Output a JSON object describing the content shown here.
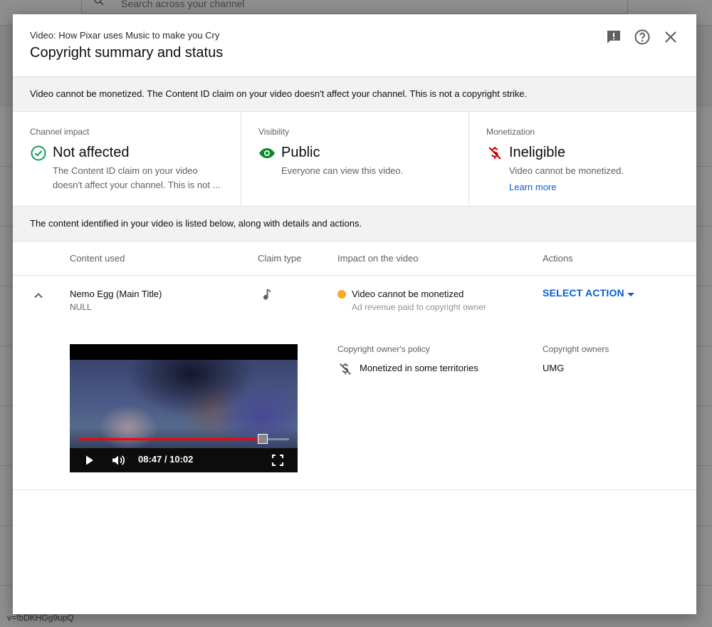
{
  "background": {
    "search_placeholder": "Search across your channel",
    "footer_text": "v=fbDKHGg9upQ"
  },
  "dialog": {
    "video_subtitle": "Video: How Pixar uses Music to make you Cry",
    "title": "Copyright summary and status",
    "notice": "Video cannot be monetized. The Content ID claim on your video doesn't affect your channel. This is not a copyright strike.",
    "cards": [
      {
        "label": "Channel impact",
        "value": "Not affected",
        "description": "The Content ID claim on your video doesn't affect your channel. This is not ...",
        "icon": "check-circle-icon",
        "color": "#0f9d58"
      },
      {
        "label": "Visibility",
        "value": "Public",
        "description": "Everyone can view this video.",
        "icon": "eye-icon",
        "color": "#0a8a2a"
      },
      {
        "label": "Monetization",
        "value": "Ineligible",
        "description": "Video cannot be monetized.",
        "link": "Learn more",
        "icon": "dollar-off-icon",
        "color": "#cc0000"
      }
    ],
    "table_notice": "The content identified in your video is listed below, along with details and actions.",
    "columns": {
      "content": "Content used",
      "claim_type": "Claim type",
      "impact": "Impact on the video",
      "actions": "Actions"
    },
    "claim": {
      "title": "Nemo Egg (Main Title)",
      "subtitle": "NULL",
      "claim_type_icon": "music-note-icon",
      "impact_title": "Video cannot be monetized",
      "impact_sub": "Ad revenue paid to copyright owner",
      "status_color": "#f9a825",
      "action_label": "SELECT ACTION",
      "policy_label": "Copyright owner's policy",
      "policy_value": "Monetized in some territories",
      "owners_label": "Copyright owners",
      "owners_value": "UMG",
      "player": {
        "time": "08:47 / 10:02",
        "progress": 0.876
      }
    },
    "accent_color": "#065fd4"
  }
}
